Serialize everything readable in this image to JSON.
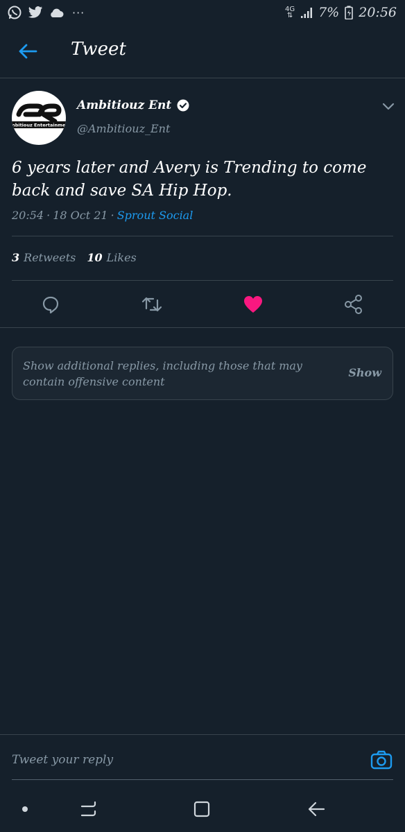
{
  "status_bar": {
    "network": "4G",
    "battery_percent": "7%",
    "time": "20:56",
    "more": "···",
    "left_icons": [
      "whatsapp-icon",
      "twitter-icon",
      "cloud-icon"
    ]
  },
  "header": {
    "title": "Tweet"
  },
  "tweet": {
    "author_name": "Ambitiouz Ent",
    "verified": true,
    "handle": "@Ambitiouz_Ent",
    "avatar_text": "Ambitiouz Entertainment",
    "text": "6 years later and Avery is Trending to come back and save SA Hip Hop.",
    "time": "20:54",
    "date": "18 Oct 21",
    "separator": "·",
    "source": "Sprout Social",
    "retweets_count": "3",
    "retweets_label": "Retweets",
    "likes_count": "10",
    "likes_label": "Likes",
    "liked": true
  },
  "additional_replies": {
    "text": "Show additional replies, including those that may contain offensive content",
    "show_label": "Show"
  },
  "reply": {
    "placeholder": "Tweet your reply"
  },
  "colors": {
    "background": "#15202b",
    "accent": "#1d9bf0",
    "like": "#f91880",
    "muted": "#8899a6",
    "border": "#38444d"
  }
}
